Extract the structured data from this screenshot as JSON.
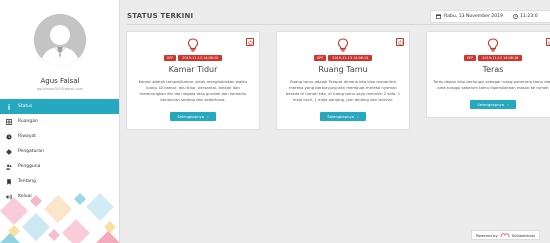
{
  "user": {
    "name": "Agus Faisal",
    "email": "agusfaisal303@gmail.com"
  },
  "nav": [
    {
      "label": "Status",
      "icon": "info-icon",
      "active": true
    },
    {
      "label": "Ruangan",
      "icon": "table-icon",
      "active": false
    },
    {
      "label": "Riwayat",
      "icon": "history-icon",
      "active": false
    },
    {
      "label": "Pengaturan",
      "icon": "gear-icon",
      "active": false
    },
    {
      "label": "Pengguna",
      "icon": "users-icon",
      "active": false
    },
    {
      "label": "Tentang",
      "icon": "bookmark-icon",
      "active": false
    },
    {
      "label": "Keluar",
      "icon": "logout-icon",
      "active": false
    }
  ],
  "header": {
    "title": "STATUS TERKINI",
    "date": "Rabu, 13 November 2019",
    "time": "11:23:0"
  },
  "rooms": [
    {
      "status": "OFF",
      "timestamp": "2019-11-13 14:08:10",
      "name": "Kamar Tidur",
      "description": "Kamar adalah tempat/kamar untuk menghabiskan waktu luang. Di kamar, aku tidur, bersantai, belajar dan merenungkan diri dari segala rasa gundah dan kamarku berukuran sedang dan sederhana.",
      "button": "Selengkapnya"
    },
    {
      "status": "OFF",
      "timestamp": "2019-11-13 14:08:15",
      "name": "Ruang Tamu",
      "description": "Ruang tamu adalah Tempat dimana kita bisa menerima mereka yang berkunjung dan membuat mereka nyaman berada di rumah kita, di ruang tamu saya memiliki 2 sofa, 1 meja kecil, 1 meja panjang, jam dinding dan televisi.",
      "button": "Selengkapnya"
    },
    {
      "status": "OFF",
      "timestamp": "2019-11-13 14:08:18",
      "name": "Teras",
      "description": "Teras depan bisa berfungsi sebagai ruang penerima tamu atau area tunggu sebelum tamu dipersilahkan masuk ke rumah",
      "button": "Selengkapnya"
    }
  ],
  "footer": {
    "powered_label": "Powered by",
    "brand": "000webhost"
  },
  "colors": {
    "accent": "#26a8bf",
    "danger": "#d0342c",
    "sidebar_bg": "#ffffff",
    "page_bg": "#ececec"
  }
}
